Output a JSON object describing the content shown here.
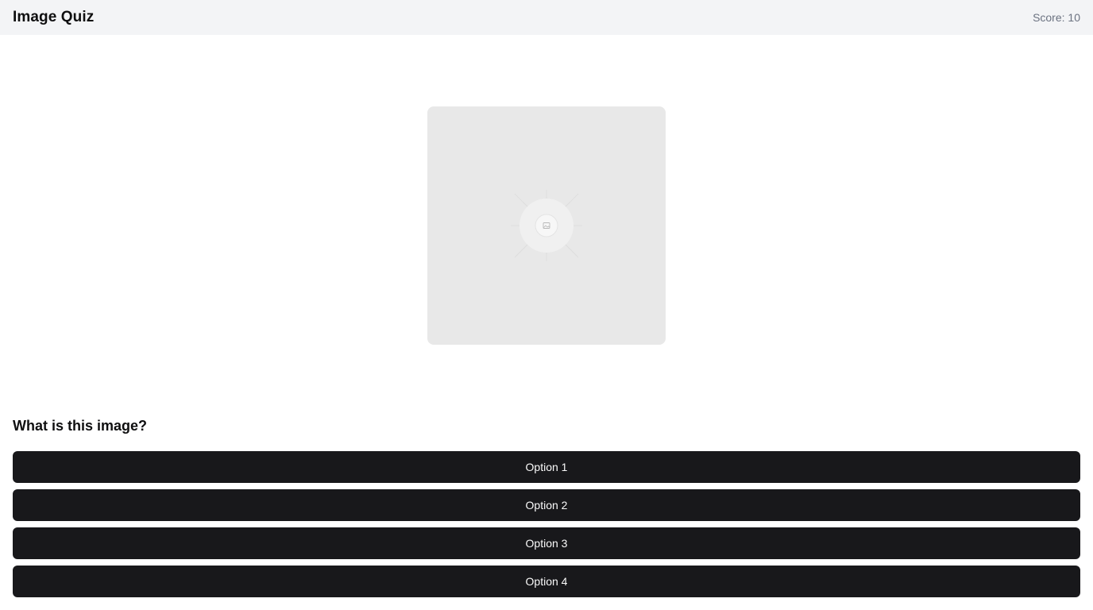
{
  "header": {
    "title": "Image Quiz",
    "score": "Score: 10"
  },
  "quiz": {
    "image_icon": "image-placeholder-icon",
    "question": "What is this image?",
    "options": [
      {
        "label": "Option 1"
      },
      {
        "label": "Option 2"
      },
      {
        "label": "Option 3"
      },
      {
        "label": "Option 4"
      }
    ]
  },
  "colors": {
    "header_bg": "#f3f4f6",
    "button_bg": "#18181b",
    "button_text": "#fafafa",
    "image_bg": "#e8e8e8",
    "muted_text": "#6b7280"
  }
}
